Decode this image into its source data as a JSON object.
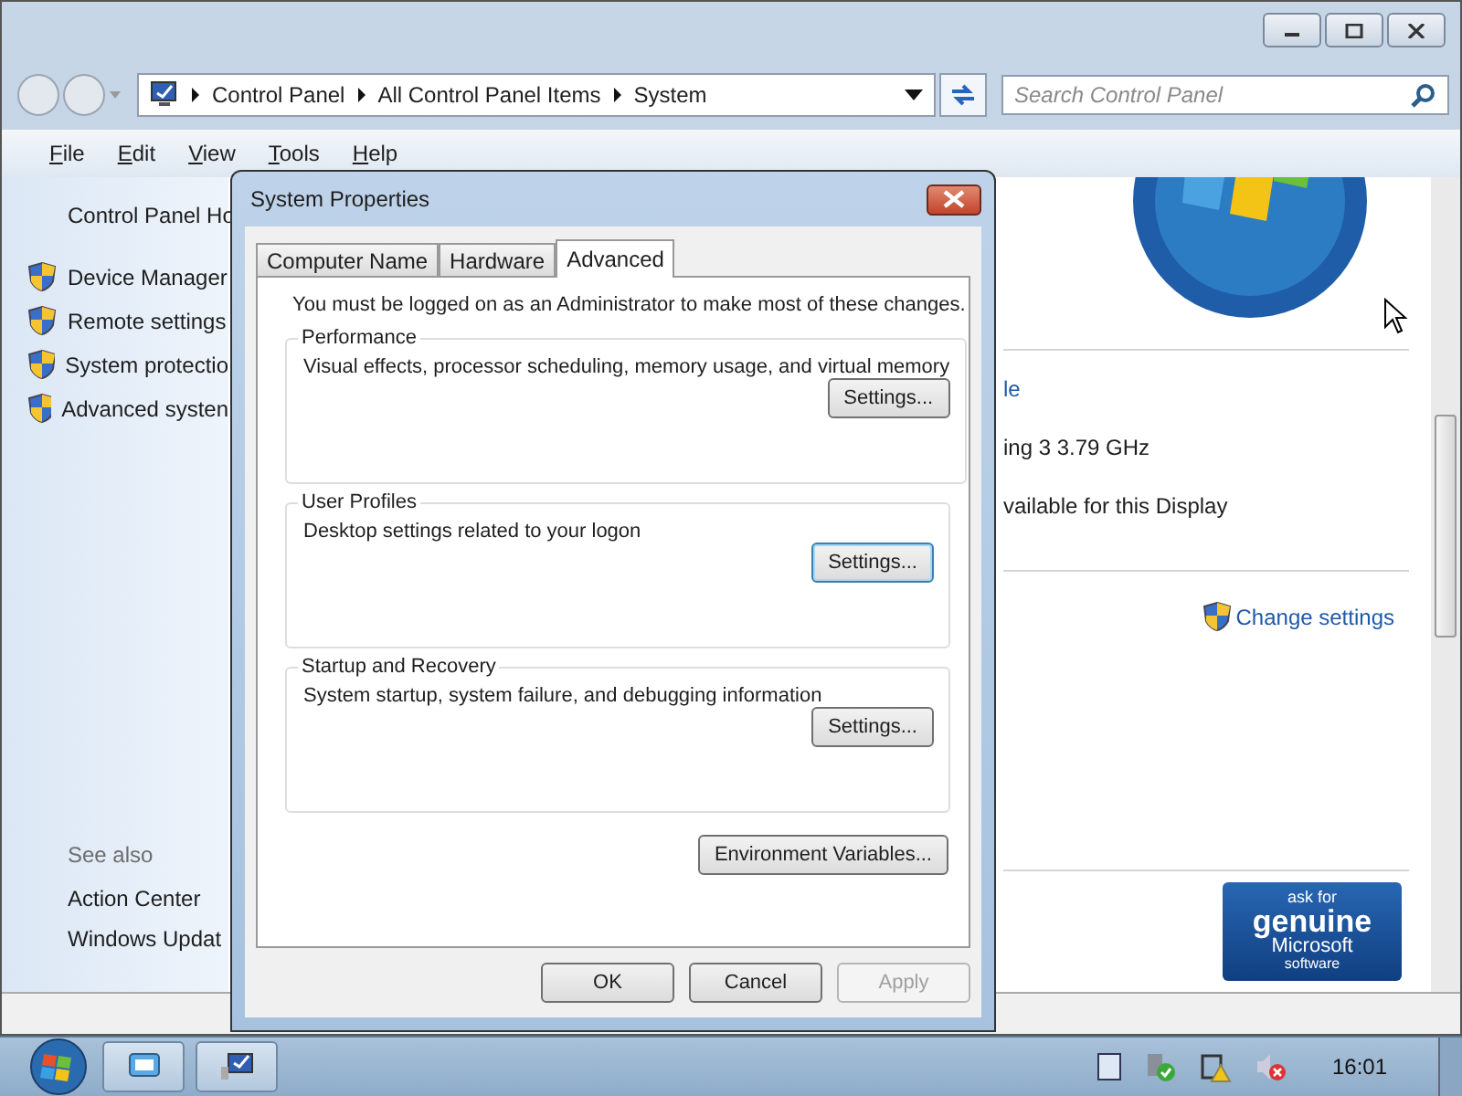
{
  "explorer": {
    "breadcrumb": [
      "Control Panel",
      "All Control Panel Items",
      "System"
    ],
    "search": {
      "placeholder": "Search Control Panel"
    },
    "menu": [
      {
        "label": "File"
      },
      {
        "label": "Edit"
      },
      {
        "label": "View"
      },
      {
        "label": "Tools"
      },
      {
        "label": "Help"
      }
    ],
    "left_pane": {
      "home": "Control Panel Ho",
      "tasks": [
        {
          "label": "Device Manager"
        },
        {
          "label": "Remote settings"
        },
        {
          "label": "System protectio"
        },
        {
          "label": "Advanced systen"
        }
      ],
      "see_also_heading": "See also",
      "see_also": [
        "Action Center",
        "Windows Updat"
      ]
    },
    "main_pane": {
      "lines": [
        {
          "kind": "link",
          "text": "le"
        },
        {
          "kind": "text",
          "text": "ing 3   3.79 GHz"
        },
        {
          "kind": "text",
          "text": "vailable for this Display"
        }
      ],
      "change_settings": "Change settings",
      "genuine_logo": [
        "ask for",
        "genuine",
        "Microsoft",
        "software"
      ]
    }
  },
  "dialog": {
    "title": "System Properties",
    "tabs": [
      {
        "label": "Computer Name",
        "selected": false
      },
      {
        "label": "Hardware",
        "selected": false
      },
      {
        "label": "Advanced",
        "selected": true
      }
    ],
    "notice": "You must be logged on as an Administrator to make most of these changes.",
    "groups": [
      {
        "title": "Performance",
        "description": "Visual effects, processor scheduling, memory usage, and virtual memory",
        "button": "Settings...",
        "focused": false
      },
      {
        "title": "User Profiles",
        "description": "Desktop settings related to your logon",
        "button": "Settings...",
        "focused": true
      },
      {
        "title": "Startup and Recovery",
        "description": "System startup, system failure, and debugging information",
        "button": "Settings...",
        "focused": false
      }
    ],
    "env_button": "Environment Variables...",
    "buttons": [
      {
        "label": "OK",
        "disabled": false
      },
      {
        "label": "Cancel",
        "disabled": false
      },
      {
        "label": "Apply",
        "disabled": true
      }
    ]
  },
  "taskbar": {
    "clock": "16:01"
  }
}
